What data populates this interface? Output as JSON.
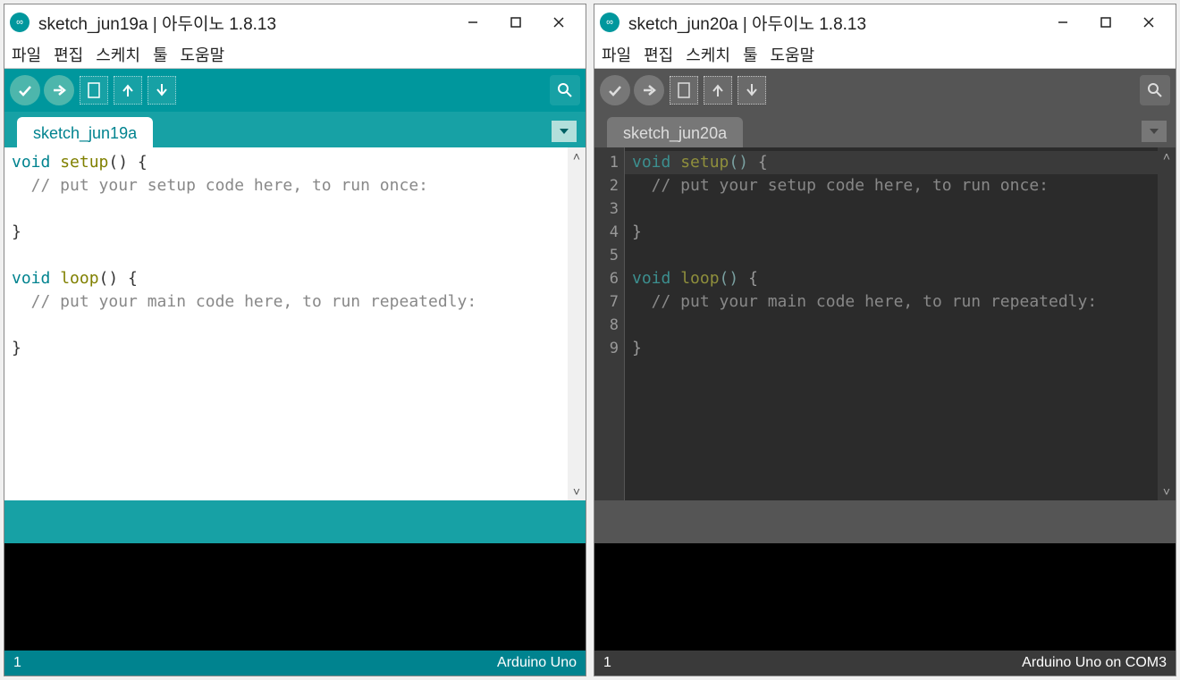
{
  "windows": [
    {
      "title": "sketch_jun19a | 아두이노 1.8.13",
      "menu": [
        "파일",
        "편집",
        "스케치",
        "툴",
        "도움말"
      ],
      "tab": "sketch_jun19a",
      "theme": "light",
      "status_left": "1",
      "status_right": "Arduino Uno",
      "code_lines": [
        [
          {
            "t": "void ",
            "c": "kw-light"
          },
          {
            "t": "setup",
            "c": "fn-light"
          },
          {
            "t": "() {",
            "c": ""
          }
        ],
        [
          {
            "t": "  // put your setup code here, to run once:",
            "c": "cm-light"
          }
        ],
        [
          {
            "t": "",
            "c": ""
          }
        ],
        [
          {
            "t": "}",
            "c": ""
          }
        ],
        [
          {
            "t": "",
            "c": ""
          }
        ],
        [
          {
            "t": "void ",
            "c": "kw-light"
          },
          {
            "t": "loop",
            "c": "fn-light"
          },
          {
            "t": "() {",
            "c": ""
          }
        ],
        [
          {
            "t": "  // put your main code here, to run repeatedly:",
            "c": "cm-light"
          }
        ],
        [
          {
            "t": "",
            "c": ""
          }
        ],
        [
          {
            "t": "}",
            "c": ""
          }
        ]
      ]
    },
    {
      "title": "sketch_jun20a | 아두이노 1.8.13",
      "menu": [
        "파일",
        "편집",
        "스케치",
        "툴",
        "도움말"
      ],
      "tab": "sketch_jun20a",
      "theme": "dark",
      "status_left": "1",
      "status_right": "Arduino Uno on COM3",
      "line_numbers": [
        "1",
        "2",
        "3",
        "4",
        "5",
        "6",
        "7",
        "8",
        "9"
      ],
      "code_lines": [
        [
          {
            "t": "void ",
            "c": "kw-dark"
          },
          {
            "t": "setup",
            "c": "fn-dark"
          },
          {
            "t": "()",
            "c": "p-dark"
          },
          {
            "t": " {",
            "c": "br-dark"
          }
        ],
        [
          {
            "t": "  // put your setup code here, to run once:",
            "c": "cm-dark"
          }
        ],
        [
          {
            "t": "",
            "c": ""
          }
        ],
        [
          {
            "t": "}",
            "c": "br-dark"
          }
        ],
        [
          {
            "t": "",
            "c": ""
          }
        ],
        [
          {
            "t": "void ",
            "c": "kw-dark"
          },
          {
            "t": "loop",
            "c": "fn-dark"
          },
          {
            "t": "()",
            "c": "p-dark"
          },
          {
            "t": " {",
            "c": "br-dark"
          }
        ],
        [
          {
            "t": "  // put your main code here, to run repeatedly:",
            "c": "cm-dark"
          }
        ],
        [
          {
            "t": "",
            "c": ""
          }
        ],
        [
          {
            "t": "}",
            "c": "br-dark"
          }
        ]
      ]
    }
  ],
  "icons": {
    "verify": "✓",
    "upload": "➜",
    "new": "▭",
    "open": "↑",
    "save": "↓",
    "serial": "🔍"
  }
}
